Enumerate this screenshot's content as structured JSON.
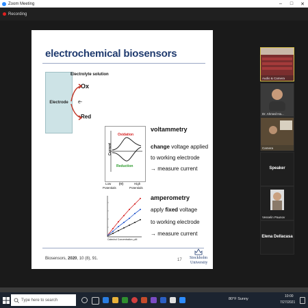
{
  "window": {
    "title": "Zoom Meeting",
    "recording_label": "Recording"
  },
  "slide": {
    "title": "electrochemical biosensors",
    "electrode_label": "Electrode",
    "electrolyte_label": "Electrolyte solution",
    "ox_label": "Ox",
    "electron_label": "e-",
    "red_label": "Red",
    "voltammetry": {
      "heading": "voltammetry",
      "body_bold": "change",
      "body_line1_rest": " voltage applied",
      "body_line2": "to working electrode",
      "body_line3": "→ measure current",
      "y_axis": "Current",
      "oxidation": "Oxidation",
      "reduction": "Reduction",
      "x_low": "Low",
      "x_unit": "(V)",
      "x_high": "High",
      "x_low_sub": "Potentials",
      "x_high_sub": "Potentials"
    },
    "amperometry": {
      "heading": "amperometry",
      "body_pre": "apply ",
      "body_bold": "fixed",
      "body_line1_rest": " voltage",
      "body_line2": "to working electrode",
      "body_line3": "→ measure current",
      "x_axis": "Catechol Concentration, µM"
    },
    "reference_journal": "Biosensors",
    "reference_year": "2020",
    "reference_rest": ", 10 (8), 91.",
    "page_number": "17",
    "logo_line1": "Stockholm",
    "logo_line2": "University"
  },
  "participants": [
    {
      "name": "Audio & Camera"
    },
    {
      "name": "Dr. Ahmed Ha..."
    },
    {
      "name": "Camera"
    },
    {
      "name": "Speaker"
    },
    {
      "name": "Vesselin Paunov"
    },
    {
      "name": "Elena Dellacasa"
    }
  ],
  "taskbar": {
    "search_placeholder": "Type here to search",
    "weather": "80°F  Sunny",
    "time": "10:00",
    "date": "7/27/2021"
  },
  "colors": {
    "slide_title": "#1f3a6e",
    "oxidation": "#d62020",
    "reduction": "#2a9a2a",
    "accent": "#2d8cff"
  }
}
